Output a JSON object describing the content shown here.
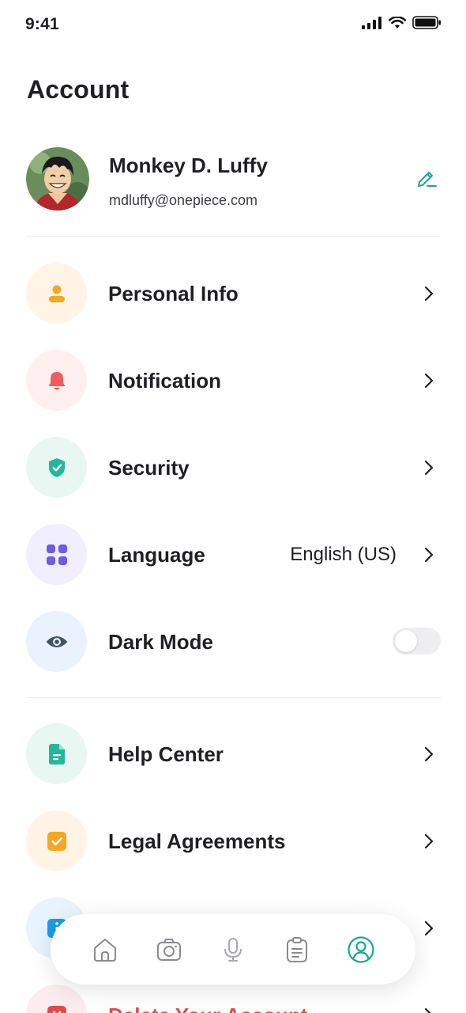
{
  "status_bar": {
    "time": "9:41",
    "icons": [
      "signal-icon",
      "wifi-icon",
      "battery-icon"
    ]
  },
  "page": {
    "title": "Account"
  },
  "profile": {
    "name": "Monkey D. Luffy",
    "email": "mdluffy@onepiece.com",
    "edit_icon": "edit-pencil-icon"
  },
  "colors": {
    "accent": "#1aa88f",
    "orange": "#f5a623",
    "red": "#f15b5b",
    "green": "#22b89b",
    "purple": "#6c5ce7",
    "slate": "#3f5560",
    "danger": "#e24a4a"
  },
  "menu": {
    "items": [
      {
        "label": "Personal Info",
        "icon": "user-icon",
        "icon_bg": "#fff4e6",
        "icon_color": "#f5a623"
      },
      {
        "label": "Notification",
        "icon": "bell-icon",
        "icon_bg": "#fff0f0",
        "icon_color": "#f15b5b"
      },
      {
        "label": "Security",
        "icon": "shield-icon",
        "icon_bg": "#e9f7f2",
        "icon_color": "#22b89b"
      },
      {
        "label": "Language",
        "value": "English (US)",
        "icon": "grid-icon",
        "icon_bg": "#f1effd",
        "icon_color": "#6c5ce7"
      },
      {
        "label": "Dark Mode",
        "icon": "eye-icon",
        "icon_bg": "#eaf2fd",
        "icon_color": "#3f5560",
        "toggle_on": false
      },
      {
        "label": "Help Center",
        "icon": "document-icon",
        "icon_bg": "#e9f7f2",
        "icon_color": "#22b89b"
      },
      {
        "label": "Legal Agreements",
        "icon": "checkbox-icon",
        "icon_bg": "#fff4e6",
        "icon_color": "#f5a623"
      },
      {
        "label": "",
        "icon": "info-icon",
        "icon_bg": "#e7f4fd",
        "icon_color": "#1a9de8"
      },
      {
        "label": "Delete Your Account",
        "icon": "delete-icon",
        "icon_bg": "#fdeced",
        "icon_color": "#e24a4a"
      }
    ]
  },
  "bottom_nav": {
    "items": [
      {
        "icon": "home-icon",
        "active": false
      },
      {
        "icon": "camera-icon",
        "active": false
      },
      {
        "icon": "microphone-icon",
        "active": false
      },
      {
        "icon": "clipboard-icon",
        "active": false
      },
      {
        "icon": "profile-icon",
        "active": true
      }
    ]
  }
}
